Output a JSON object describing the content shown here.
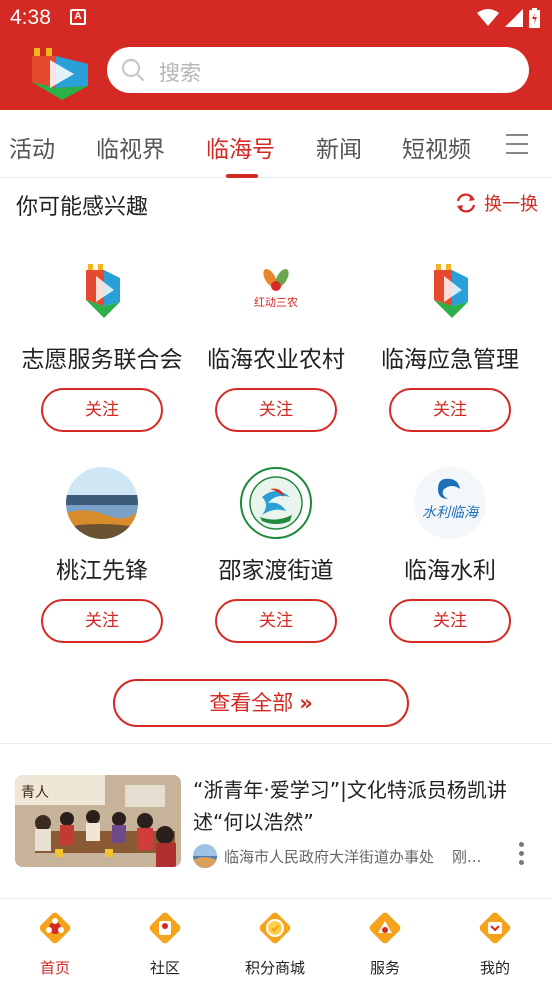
{
  "status_bar": {
    "time": "4:38",
    "notification_letter": "A"
  },
  "search": {
    "placeholder": "搜索"
  },
  "tabs": [
    {
      "label": "活动"
    },
    {
      "label": "临视界"
    },
    {
      "label": "临海号",
      "active": true
    },
    {
      "label": "新闻"
    },
    {
      "label": "短视频"
    }
  ],
  "interest": {
    "title": "你可能感兴趣",
    "refresh_label": "换一换",
    "follow_label": "关注",
    "accounts": [
      {
        "name": "志愿服务联合会",
        "icon": "cube-logo-icon"
      },
      {
        "name": "临海农业农村",
        "icon": "red-sannong-logo-icon",
        "logo_text": "红动三农"
      },
      {
        "name": "临海应急管理",
        "icon": "cube-logo-icon"
      },
      {
        "name": "桃江先锋",
        "icon": "landscape-photo-icon"
      },
      {
        "name": "邵家渡街道",
        "icon": "green-circle-logo-icon"
      },
      {
        "name": "临海水利",
        "icon": "water-logo-icon",
        "logo_text": "水利临海"
      }
    ],
    "view_all_label": "查看全部"
  },
  "news": {
    "title": "“浙青年·爱学习”|文化特派员杨凯讲述“何以浩然”",
    "source": "临海市人民政府大洋街道办事处",
    "time": "刚..."
  },
  "bottom_nav": [
    {
      "label": "首页",
      "active": true,
      "icon": "home-icon"
    },
    {
      "label": "社区",
      "icon": "community-icon"
    },
    {
      "label": "积分商城",
      "icon": "points-mall-icon"
    },
    {
      "label": "服务",
      "icon": "service-icon"
    },
    {
      "label": "我的",
      "icon": "profile-icon"
    }
  ],
  "colors": {
    "brand_red": "#d42a23",
    "nav_icon_orange": "#f5a31a"
  }
}
